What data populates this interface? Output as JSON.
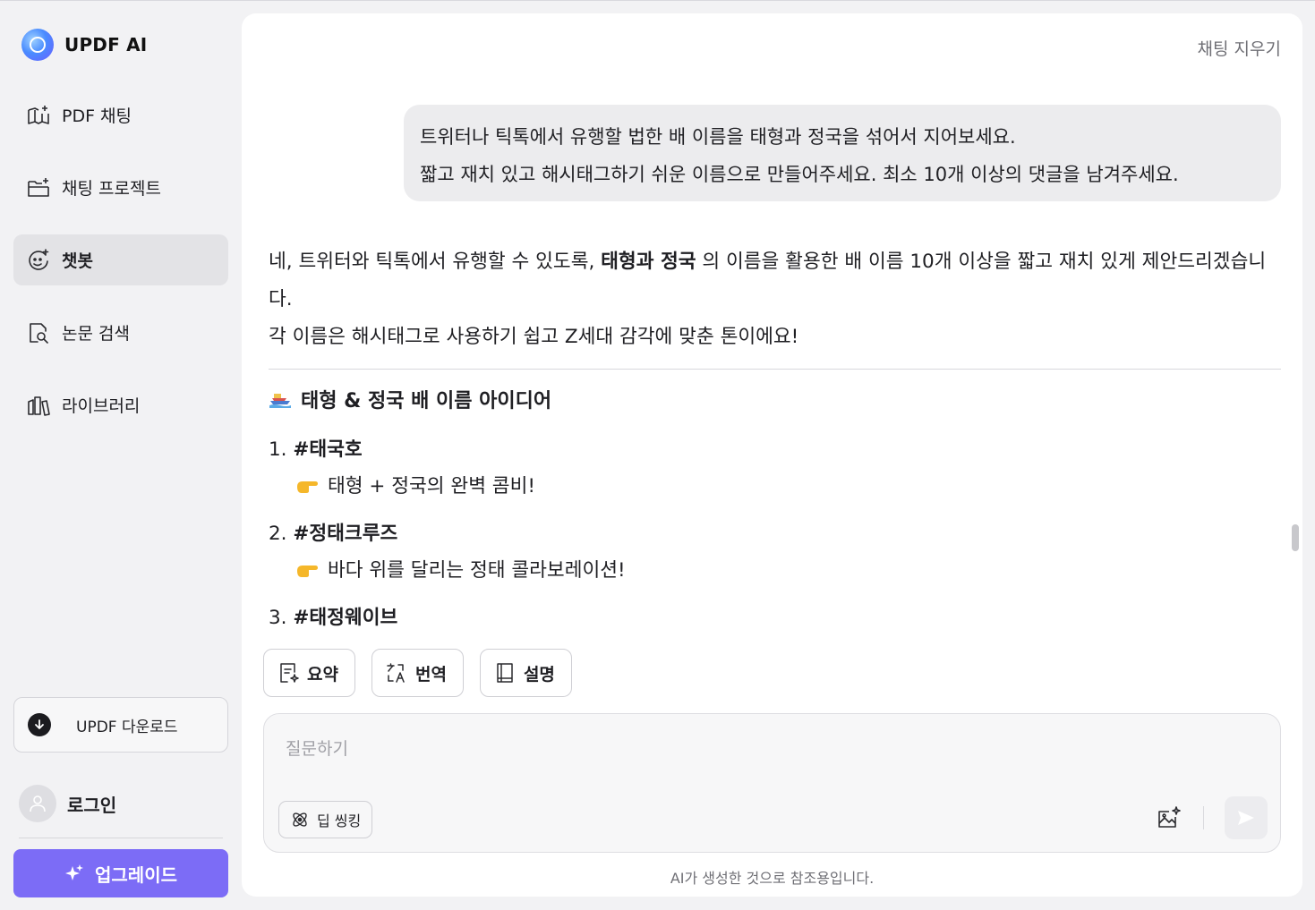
{
  "app": {
    "name": "UPDF AI"
  },
  "sidebar": {
    "items": [
      {
        "label": "PDF 채팅",
        "icon": "book-open-sparkle-icon"
      },
      {
        "label": "채팅 프로젝트",
        "icon": "folder-sparkle-icon"
      },
      {
        "label": "챗봇",
        "icon": "chatbot-face-icon",
        "active": true
      },
      {
        "label": "논문 검색",
        "icon": "document-search-icon"
      },
      {
        "label": "라이브러리",
        "icon": "library-books-icon"
      }
    ],
    "download_label": "UPDF 다운로드",
    "login_label": "로그인",
    "upgrade_label": "업그레이드"
  },
  "header": {
    "clear_chat": "채팅 지우기"
  },
  "conversation": {
    "user_message": {
      "line1": "트위터나 틱톡에서 유행할 법한 배 이름을 태형과 정국을 섞어서 지어보세요.",
      "line2": "짧고 재치 있고 해시태그하기 쉬운 이름으로 만들어주세요. 최소 10개 이상의 댓글을 남겨주세요."
    },
    "assistant": {
      "intro_a": "네, 트위터와 틱톡에서 유행할 수 있도록, ",
      "intro_bold": "태형과 정국",
      "intro_b": " 의 이름을 활용한 배 이름 10개 이상을 짧고 재치 있게 제안드리겠습니다.",
      "intro_2": "각 이름은 해시태그로 사용하기 쉽고 Z세대 감각에 맞춘 톤이에요!",
      "section_title": "태형 & 정국 배 이름 아이디어",
      "items": [
        {
          "num": "1.",
          "tag": "#태국호",
          "desc": "태형 + 정국의 완벽 콤비!"
        },
        {
          "num": "2.",
          "tag": "#정태크루즈",
          "desc": "바다 위를 달리는 정태 콜라보레이션!"
        },
        {
          "num": "3.",
          "tag": "#태정웨이브",
          "desc": ""
        }
      ]
    }
  },
  "actions": {
    "summarize": "요약",
    "translate": "번역",
    "explain": "설명"
  },
  "input": {
    "placeholder": "질문하기",
    "deep_think_label": "딥 씽킹"
  },
  "footnote": "AI가 생성한 것으로 참조용입니다.",
  "colors": {
    "accent": "#7c6cf6",
    "active_nav": "#e3e3e6",
    "bubble": "#ececee"
  }
}
